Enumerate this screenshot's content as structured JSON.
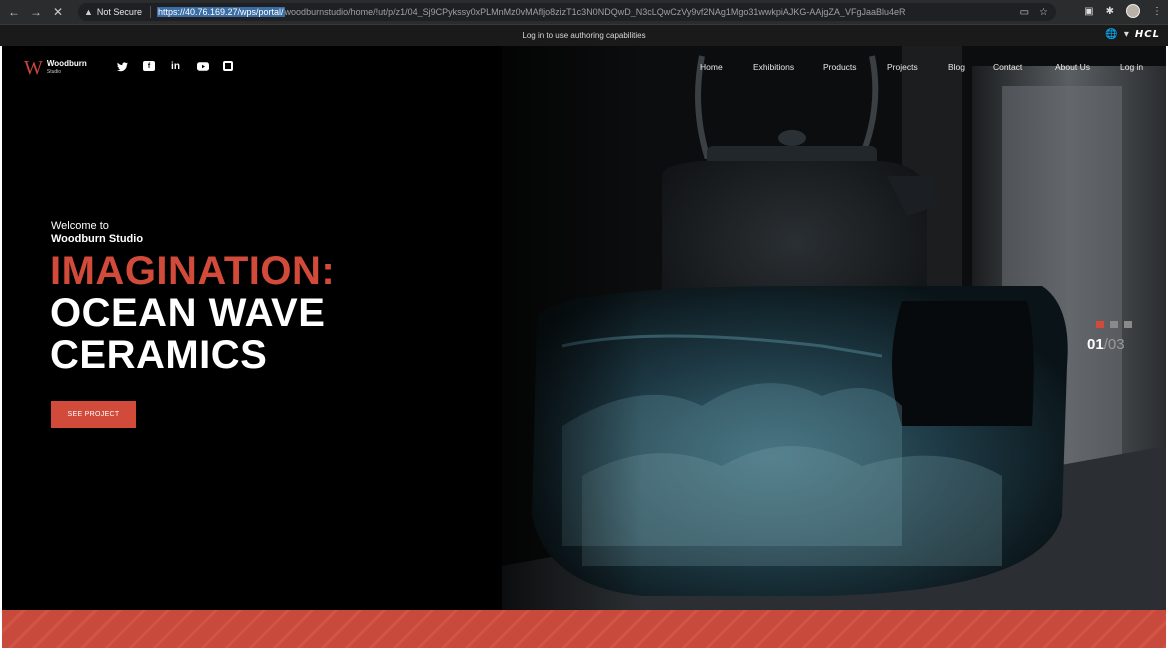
{
  "browser": {
    "security_label": "Not Secure",
    "url_highlight": "https://40.76.169.27/wps/portal/",
    "url_rest": "woodburnstudio/home/!ut/p/z1/04_Sj9CPykssy0xPLMnMz0vMAfljo8zizT1c3N0NDQwD_N3cLQwCzVy9vf2NAg1Mgo31wwkpiAJKG-AAjgZA_VFgJaaBlu4eR",
    "brand_logo": "HCL"
  },
  "authoring_bar": {
    "message": "Log in to use authoring capabilities"
  },
  "site": {
    "brand_name": "Woodburn",
    "brand_sub": "Studio",
    "brand_mark": "W",
    "social": [
      "twitter-icon",
      "facebook-icon",
      "linkedin-icon",
      "youtube-icon",
      "instagram-icon"
    ],
    "nav": [
      "Home",
      "Exhibitions",
      "Products",
      "Projects",
      "Blog",
      "Contact",
      "About Us",
      "Log in"
    ]
  },
  "hero": {
    "welcome_line1": "Welcome to",
    "welcome_line2": "Woodburn Studio",
    "headline_accent": "IMAGINATION:",
    "headline_line1": "OCEAN WAVE",
    "headline_line2": "CERAMICS",
    "cta_label": "SEE PROJECT",
    "slide_current": "01",
    "slide_separator": "/",
    "slide_total": "03",
    "accent_color": "#d24a3a"
  }
}
